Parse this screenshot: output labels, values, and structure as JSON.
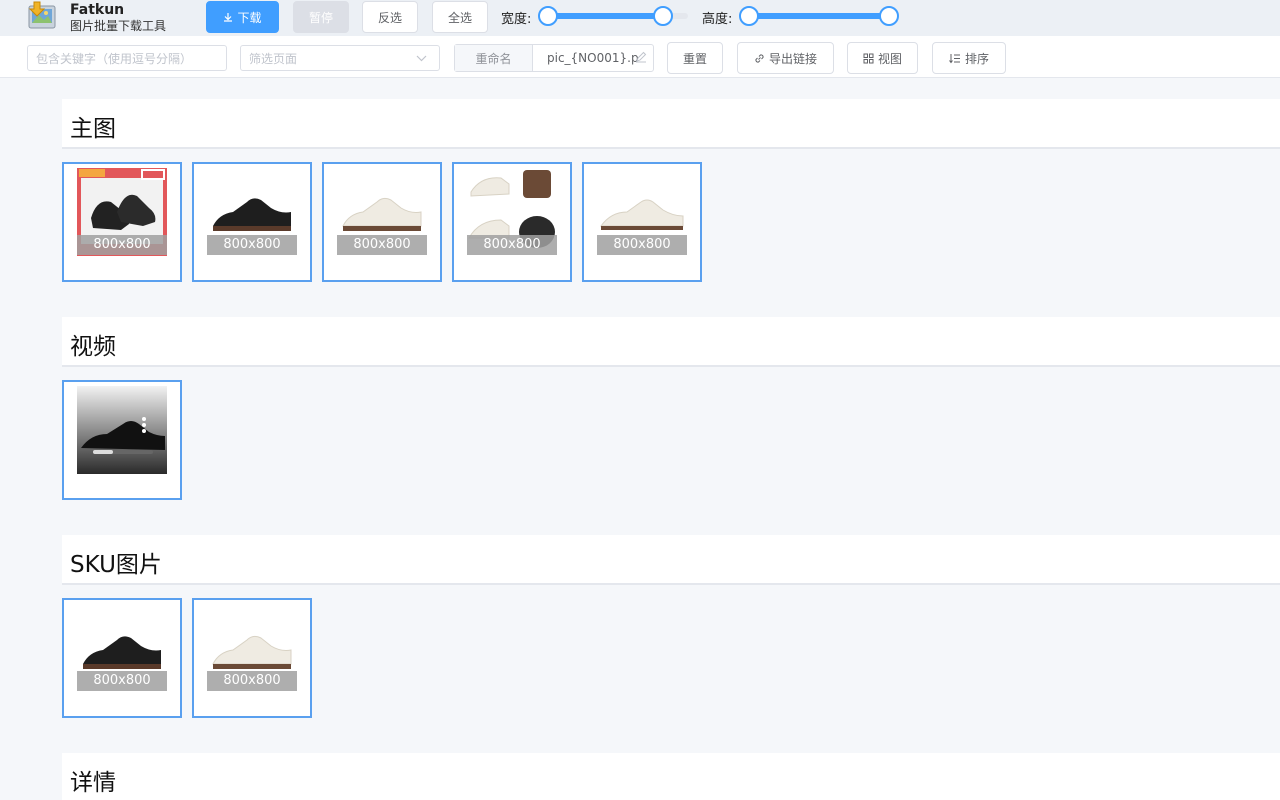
{
  "app": {
    "name": "Fatkun",
    "subtitle": "图片批量下载工具"
  },
  "toolbar": {
    "download_label": "下载",
    "pause_label": "暂停",
    "invert_label": "反选",
    "select_all_label": "全选",
    "width_label": "宽度:",
    "height_label": "高度:",
    "width_range": [
      0.0,
      0.82
    ],
    "height_range": [
      0.0,
      1.0
    ]
  },
  "filters": {
    "keyword_placeholder": "包含关键字（使用逗号分隔）",
    "page_placeholder": "筛选页面",
    "rename_label": "重命名",
    "rename_value": "pic_{NO001}.p",
    "reset_label": "重置",
    "export_label": "导出链接",
    "view_label": "视图",
    "sort_label": "排序"
  },
  "sections": [
    {
      "title": "主图",
      "images": [
        {
          "size": "800x800",
          "kind": "black-shoe-promo"
        },
        {
          "size": "800x800",
          "kind": "black-shoe"
        },
        {
          "size": "800x800",
          "kind": "white-shoe"
        },
        {
          "size": "800x800",
          "kind": "white-shoe-collage"
        },
        {
          "size": "800x800",
          "kind": "white-shoe"
        }
      ]
    },
    {
      "title": "视频",
      "images": [
        {
          "size": "",
          "kind": "video-black-shoe"
        }
      ]
    },
    {
      "title": "SKU图片",
      "images": [
        {
          "size": "800x800",
          "kind": "black-shoe"
        },
        {
          "size": "800x800",
          "kind": "white-shoe"
        }
      ]
    },
    {
      "title": "详情",
      "images": []
    }
  ],
  "colors": {
    "accent": "#409eff",
    "thumb_border": "#5aa0ef"
  }
}
